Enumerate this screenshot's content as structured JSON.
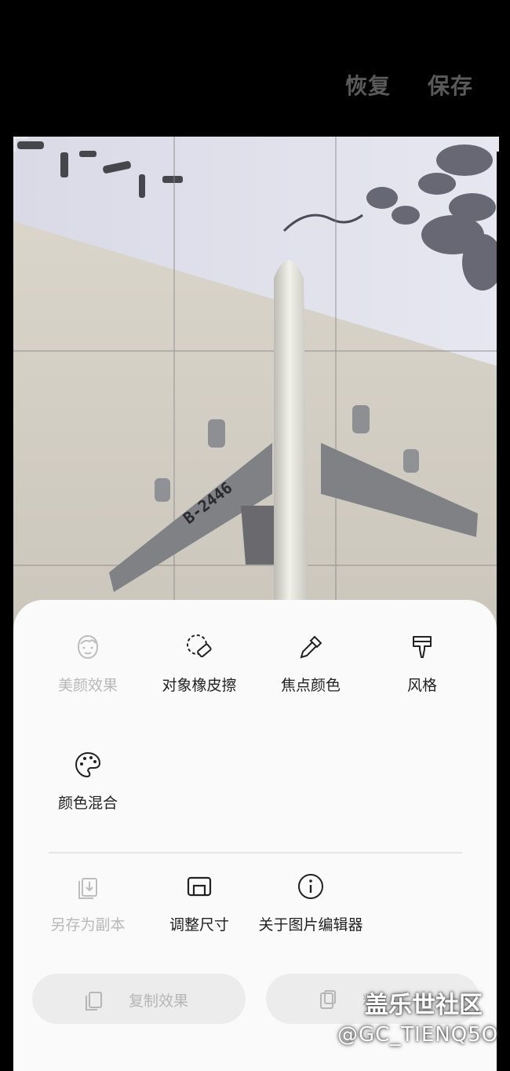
{
  "header": {
    "restore_label": "恢复",
    "save_label": "保存"
  },
  "canvas": {
    "registration": "B-2446"
  },
  "tools": [
    {
      "label": "美颜效果",
      "icon": "face-icon",
      "enabled": false
    },
    {
      "label": "对象橡皮擦",
      "icon": "object-eraser-icon",
      "enabled": true
    },
    {
      "label": "焦点颜色",
      "icon": "eyedropper-icon",
      "enabled": true
    },
    {
      "label": "风格",
      "icon": "paint-brush-icon",
      "enabled": true
    },
    {
      "label": "颜色混合",
      "icon": "palette-icon",
      "enabled": true
    }
  ],
  "more_tools": [
    {
      "label": "另存为副本",
      "icon": "save-copy-icon",
      "enabled": false
    },
    {
      "label": "调整尺寸",
      "icon": "resize-icon",
      "enabled": true
    },
    {
      "label": "关于图片编辑器",
      "icon": "info-icon",
      "enabled": true
    }
  ],
  "actions": {
    "copy_effect_label": "复制效果",
    "paste_effect_label": "粘"
  },
  "watermark": {
    "line1": "盖乐世社区",
    "line2": "@GC_TIENQ5O"
  },
  "colors": {
    "accent_disabled": "#b8b8b8",
    "sheet_bg": "#fafafa",
    "header_text": "#5a5a5a"
  }
}
